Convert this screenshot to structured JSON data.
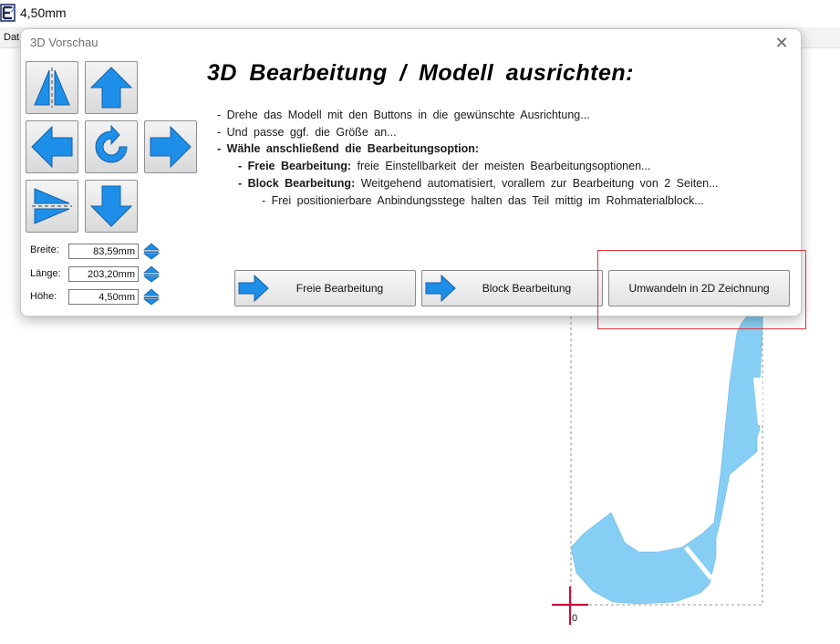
{
  "app": {
    "title": "4,50mm",
    "menu_first": "Dat",
    "logo_icon": "app-logo-icon"
  },
  "canvas": {
    "origin_label": "0",
    "part_color": "#87cef5",
    "origin_marker_color": "#c8103c"
  },
  "dialog": {
    "title": "3D Vorschau",
    "close_icon": "close-icon",
    "heading": "3D Bearbeitung / Modell ausrichten:",
    "instructions": {
      "line1": "- Drehe das Modell mit den Buttons in die gewünschte Ausrichtung...",
      "line2": "- Und passe ggf. die Größe an...",
      "line3_bold": "- Wähle anschließend die Bearbeitungsoption:",
      "line4_bold": "- Freie Bearbeitung:",
      "line4_rest": " freie Einstellbarkeit der meisten Bearbeitungsoptionen...",
      "line5_bold": "- Block Bearbeitung:",
      "line5_rest": " Weitgehend automatisiert, vorallem zur Bearbeitung von 2 Seiten...",
      "line6": "- Frei positionierbare Anbindungsstege halten das Teil mittig im Rohmaterialblock..."
    },
    "nav_buttons": [
      {
        "name": "mirror-vertical-button",
        "icon": "mirror-vertical-icon"
      },
      {
        "name": "arrow-up-button",
        "icon": "arrow-up-icon"
      },
      {
        "name": "arrow-left-button",
        "icon": "arrow-left-icon"
      },
      {
        "name": "rotate-button",
        "icon": "rotate-icon"
      },
      {
        "name": "arrow-right-button",
        "icon": "arrow-right-icon"
      },
      {
        "name": "mirror-horizontal-button",
        "icon": "mirror-horizontal-icon"
      },
      {
        "name": "arrow-down-button",
        "icon": "arrow-down-icon"
      }
    ],
    "dimensions": {
      "width_label": "Breite:",
      "width_value": "83,59mm",
      "length_label": "Länge:",
      "length_value": "203,20mm",
      "height_label": "Höhe:",
      "height_value": "4,50mm"
    },
    "actions": {
      "free_label": "Freie Bearbeitung",
      "block_label": "Block Bearbeitung",
      "convert_label": "Umwandeln in 2D Zeichnung"
    },
    "colors": {
      "icon_blue": "#1e8fe8",
      "highlight": "#e0343c"
    }
  }
}
